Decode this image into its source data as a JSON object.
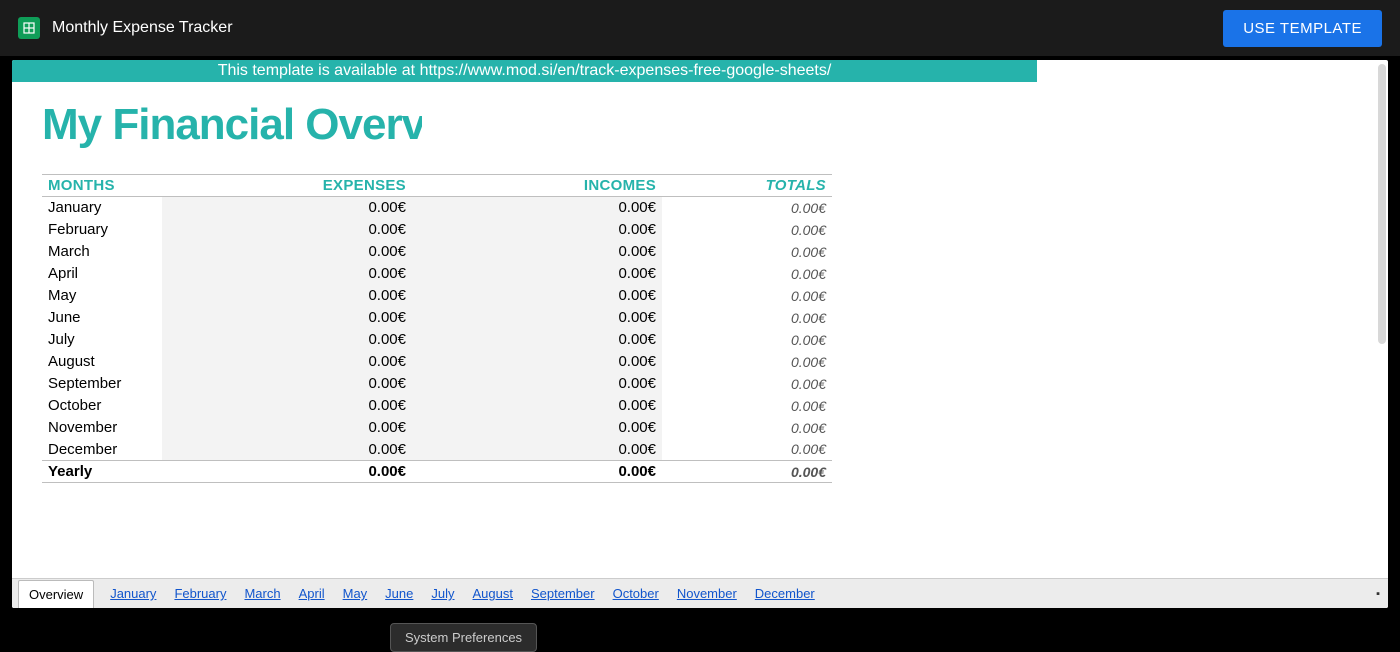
{
  "header": {
    "doc_title": "Monthly Expense Tracker",
    "use_template_label": "USE TEMPLATE"
  },
  "banner_text": "This template is available at https://www.mod.si/en/track-expenses-free-google-sheets/",
  "page_title": "My Financial Overview",
  "columns": {
    "months": "MONTHS",
    "expenses": "EXPENSES",
    "incomes": "INCOMES",
    "totals": "TOTALS"
  },
  "rows": [
    {
      "month": "January",
      "expenses": "0.00€",
      "incomes": "0.00€",
      "total": "0.00€"
    },
    {
      "month": "February",
      "expenses": "0.00€",
      "incomes": "0.00€",
      "total": "0.00€"
    },
    {
      "month": "March",
      "expenses": "0.00€",
      "incomes": "0.00€",
      "total": "0.00€"
    },
    {
      "month": "April",
      "expenses": "0.00€",
      "incomes": "0.00€",
      "total": "0.00€"
    },
    {
      "month": "May",
      "expenses": "0.00€",
      "incomes": "0.00€",
      "total": "0.00€"
    },
    {
      "month": "June",
      "expenses": "0.00€",
      "incomes": "0.00€",
      "total": "0.00€"
    },
    {
      "month": "July",
      "expenses": "0.00€",
      "incomes": "0.00€",
      "total": "0.00€"
    },
    {
      "month": "August",
      "expenses": "0.00€",
      "incomes": "0.00€",
      "total": "0.00€"
    },
    {
      "month": "September",
      "expenses": "0.00€",
      "incomes": "0.00€",
      "total": "0.00€"
    },
    {
      "month": "October",
      "expenses": "0.00€",
      "incomes": "0.00€",
      "total": "0.00€"
    },
    {
      "month": "November",
      "expenses": "0.00€",
      "incomes": "0.00€",
      "total": "0.00€"
    },
    {
      "month": "December",
      "expenses": "0.00€",
      "incomes": "0.00€",
      "total": "0.00€"
    }
  ],
  "yearly": {
    "label": "Yearly",
    "expenses": "0.00€",
    "incomes": "0.00€",
    "total": "0.00€"
  },
  "tabs": [
    "Overview",
    "January",
    "February",
    "March",
    "April",
    "May",
    "June",
    "July",
    "August",
    "September",
    "October",
    "November",
    "December"
  ],
  "active_tab_index": 0,
  "system_preferences_label": "System Preferences"
}
